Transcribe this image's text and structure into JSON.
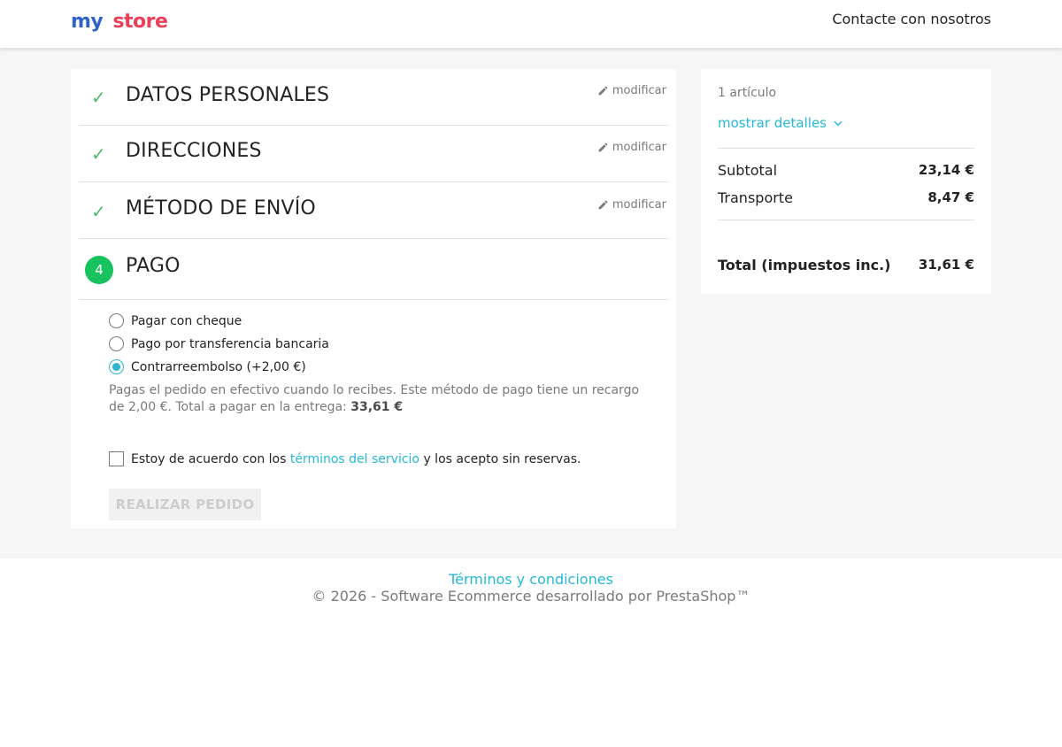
{
  "header": {
    "logo_my": "my",
    "logo_store": "store",
    "contact": "Contacte con nosotros"
  },
  "steps": {
    "personal": {
      "title": "DATOS PERSONALES",
      "edit": "modificar"
    },
    "addresses": {
      "title": "DIRECCIONES",
      "edit": "modificar"
    },
    "shipping": {
      "title": "MÉTODO DE ENVÍO",
      "edit": "modificar"
    },
    "payment": {
      "number": "4",
      "title": "PAGO"
    }
  },
  "payment": {
    "options": [
      {
        "label": "Pagar con cheque",
        "selected": false
      },
      {
        "label": "Pago por transferencia bancaria",
        "selected": false
      },
      {
        "label": "Contrarreembolso (+2,00 €)",
        "selected": true
      }
    ],
    "description": "Pagas el pedido en efectivo cuando lo recibes. Este método de pago tiene un recargo de 2,00 €. Total a pagar en la entrega: ",
    "description_amount": "33,61 €",
    "terms_before": "Estoy de acuerdo con los ",
    "terms_link": "términos del servicio",
    "terms_after": " y los acepto sin reservas.",
    "order_button": "REALIZAR PEDIDO"
  },
  "summary": {
    "items": "1 artículo",
    "details": "mostrar detalles",
    "subtotal_label": "Subtotal",
    "subtotal_value": "23,14 €",
    "shipping_label": "Transporte",
    "shipping_value": "8,47 €",
    "total_label": "Total (impuestos inc.)",
    "total_value": "31,61 €"
  },
  "footer": {
    "terms": "Términos y condiciones",
    "copyright": "© 2026 - Software Ecommerce desarrollado por PrestaShop™"
  },
  "colors": {
    "accent": "#24b9d7",
    "check": "#4cbb6c",
    "step_badge": "#17c25f"
  }
}
